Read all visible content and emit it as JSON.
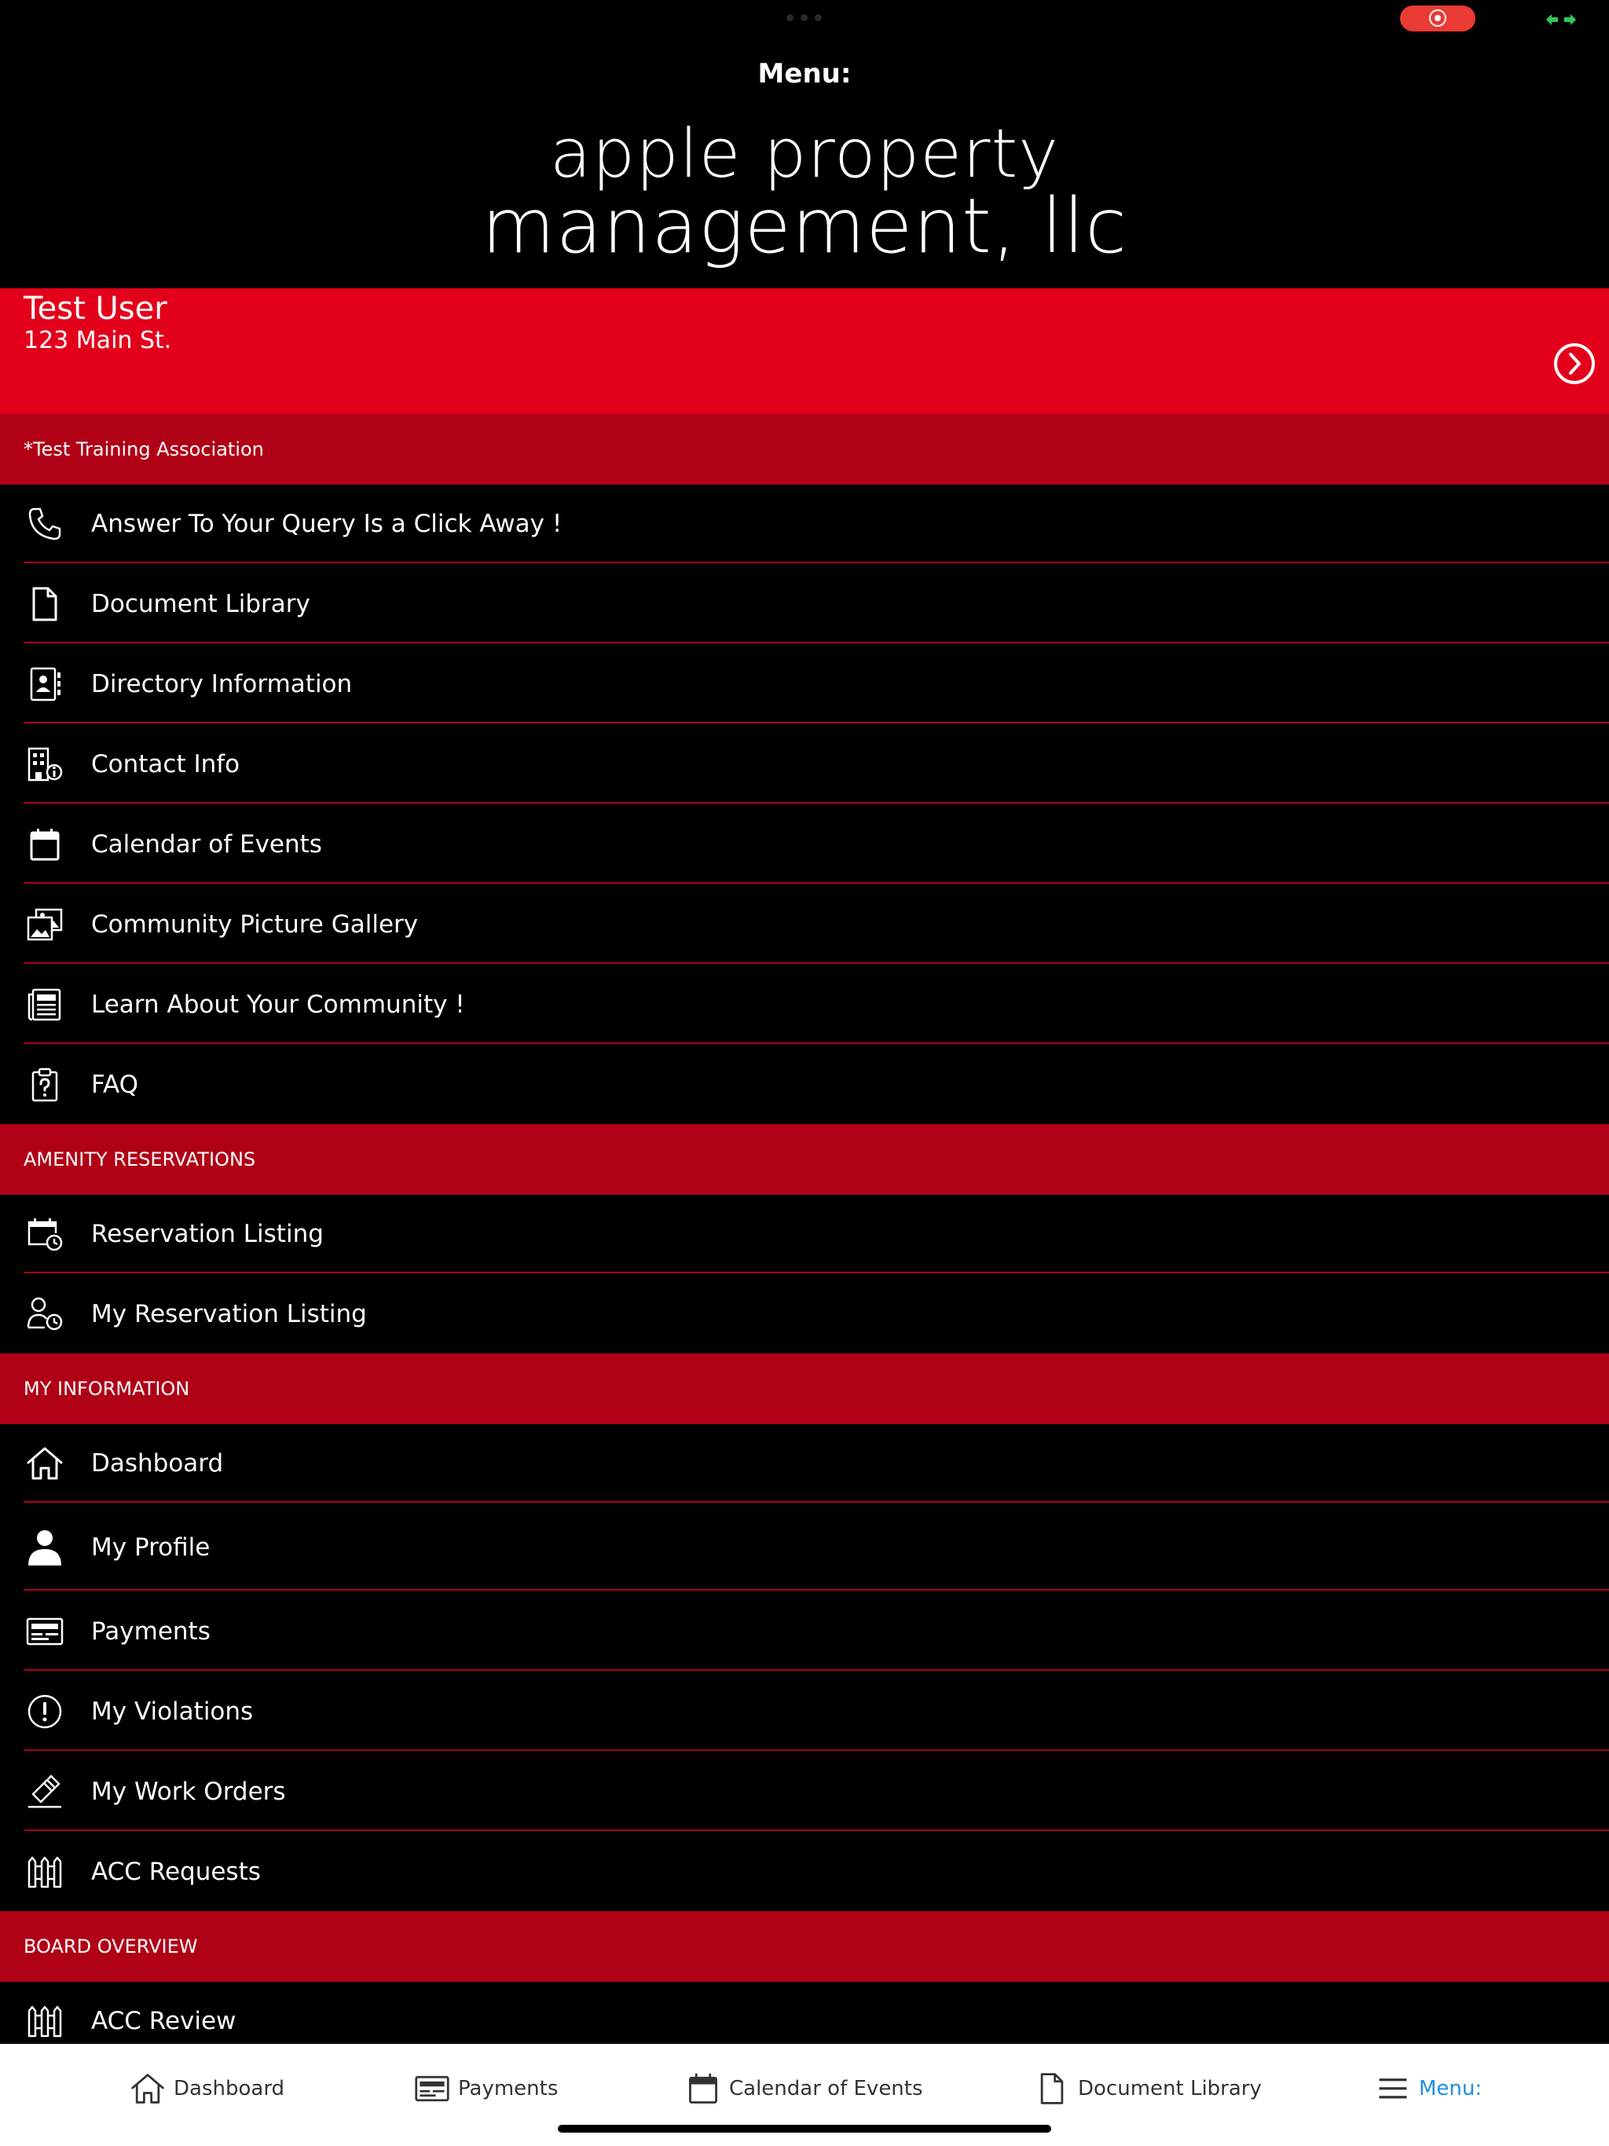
{
  "header": {
    "title": "Menu:",
    "logo_line1": "apple property",
    "logo_line2": "management, llc"
  },
  "user": {
    "name": "Test User",
    "address": "123 Main St."
  },
  "association": "*Test Training Association",
  "community_items": [
    {
      "label": "Answer To Your Query Is a Click Away !",
      "icon": "phone-icon"
    },
    {
      "label": "Document Library",
      "icon": "document-icon"
    },
    {
      "label": "Directory Information",
      "icon": "address-book-icon"
    },
    {
      "label": "Contact Info",
      "icon": "building-info-icon"
    },
    {
      "label": "Calendar of Events",
      "icon": "calendar-icon"
    },
    {
      "label": "Community Picture Gallery",
      "icon": "gallery-icon"
    },
    {
      "label": "Learn About Your Community !",
      "icon": "newspaper-icon"
    },
    {
      "label": "FAQ",
      "icon": "clipboard-question-icon"
    }
  ],
  "sections": {
    "amenity": "AMENITY RESERVATIONS",
    "my_info": "MY INFORMATION",
    "board": "BOARD OVERVIEW"
  },
  "amenity_items": [
    {
      "label": "Reservation Listing",
      "icon": "calendar-clock-icon"
    },
    {
      "label": "My Reservation Listing",
      "icon": "user-clock-icon"
    }
  ],
  "my_info_items": [
    {
      "label": "Dashboard",
      "icon": "home-icon"
    },
    {
      "label": "My Profile",
      "icon": "person-icon"
    },
    {
      "label": "Payments",
      "icon": "payment-card-icon"
    },
    {
      "label": "My Violations",
      "icon": "alert-circle-icon"
    },
    {
      "label": "My Work Orders",
      "icon": "work-order-icon"
    },
    {
      "label": "ACC Requests",
      "icon": "fence-icon"
    }
  ],
  "board_items": [
    {
      "label": "ACC Review",
      "icon": "fence-icon"
    }
  ],
  "tab_bar": {
    "dashboard": "Dashboard",
    "payments": "Payments",
    "calendar": "Calendar of Events",
    "documents": "Document Library",
    "menu": "Menu:"
  },
  "colors": {
    "user_band": "#e3001b",
    "section_header": "#b00016",
    "divider": "#a8001e",
    "active_tab": "#1e8fe0"
  }
}
